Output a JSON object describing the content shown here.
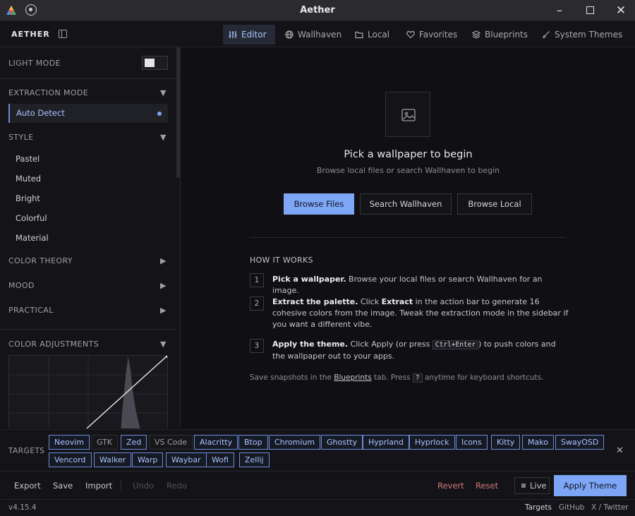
{
  "window": {
    "title": "Aether"
  },
  "header": {
    "brand": "AETHER",
    "nav": [
      {
        "label": "Editor",
        "icon": "sliders-icon",
        "active": true
      },
      {
        "label": "Wallhaven",
        "icon": "globe-icon"
      },
      {
        "label": "Local",
        "icon": "folder-icon"
      },
      {
        "label": "Favorites",
        "icon": "heart-icon"
      },
      {
        "label": "Blueprints",
        "icon": "layers-icon"
      },
      {
        "label": "System Themes",
        "icon": "brush-icon"
      }
    ]
  },
  "sidebar": {
    "light_mode_label": "LIGHT MODE",
    "light_mode_on": false,
    "extraction_mode_label": "EXTRACTION MODE",
    "extraction_mode_value": "Auto Detect",
    "style_label": "STYLE",
    "style_items": [
      "Pastel",
      "Muted",
      "Bright",
      "Colorful",
      "Material"
    ],
    "color_theory_label": "COLOR THEORY",
    "mood_label": "MOOD",
    "practical_label": "PRACTICAL",
    "color_adjustments_label": "COLOR ADJUSTMENTS"
  },
  "main": {
    "pick_title": "Pick a wallpaper to begin",
    "pick_subtitle": "Browse local files or search Wallhaven to begin",
    "browse_files": "Browse Files",
    "search_wallhaven": "Search Wallhaven",
    "browse_local": "Browse Local",
    "how_title": "HOW IT WORKS",
    "steps": [
      {
        "num": "1",
        "bold": "Pick a wallpaper.",
        "text": " Browse your local files or search Wallhaven for an image."
      },
      {
        "num": "2",
        "bold": "Extract the palette.",
        "text_a": " Click ",
        "bold_b": "Extract",
        "text_b": " in the action bar to generate 16 cohesive colors from the image. Tweak the extraction mode in the sidebar if you want a different vibe."
      },
      {
        "num": "3",
        "bold": "Apply the theme.",
        "text_a": " Click ",
        "bold_b": "Apply",
        "text_b": " (or press ",
        "kbd": "Ctrl+Enter",
        "text_c": ") to push colors and the wallpaper out to your apps."
      }
    ],
    "footnote_a": "Save snapshots in the ",
    "footnote_link": "Blueprints",
    "footnote_b": " tab. Press ",
    "footnote_kbd": "?",
    "footnote_c": " anytime for keyboard shortcuts."
  },
  "targets": {
    "label": "TARGETS",
    "chips": [
      {
        "label": "Neovim",
        "on": true
      },
      {
        "label": "GTK",
        "on": false
      },
      {
        "label": "Zed",
        "on": true
      },
      {
        "label": "VS Code",
        "on": false
      },
      {
        "label": "Alacritty",
        "on": true
      },
      {
        "label": "Btop",
        "on": true
      },
      {
        "label": "Chromium",
        "on": true
      },
      {
        "label": "Ghostty",
        "on": true
      },
      {
        "label": "Hyprland",
        "on": true
      },
      {
        "label": "Hyprlock",
        "on": true
      },
      {
        "label": "Icons",
        "on": true
      },
      {
        "label": "Kitty",
        "on": true
      },
      {
        "label": "Mako",
        "on": true
      },
      {
        "label": "SwayOSD",
        "on": true
      },
      {
        "label": "Vencord",
        "on": true
      },
      {
        "label": "Walker",
        "on": true
      },
      {
        "label": "Warp",
        "on": true
      },
      {
        "label": "Waybar",
        "on": true
      },
      {
        "label": "Wofi",
        "on": true
      },
      {
        "label": "Zellij",
        "on": true
      }
    ]
  },
  "actions": {
    "export": "Export",
    "save": "Save",
    "import": "Import",
    "undo": "Undo",
    "redo": "Redo",
    "revert": "Revert",
    "reset": "Reset",
    "live": "Live",
    "apply": "Apply Theme"
  },
  "status": {
    "version": "v4.15.4",
    "targets": "Targets",
    "github": "GitHub",
    "twitter": "X / Twitter"
  },
  "colors": {
    "accent": "#7ea6f6",
    "accent_text": "#a9c4ff",
    "danger": "#d17a78",
    "background": "#101014",
    "panel": "#141418"
  }
}
